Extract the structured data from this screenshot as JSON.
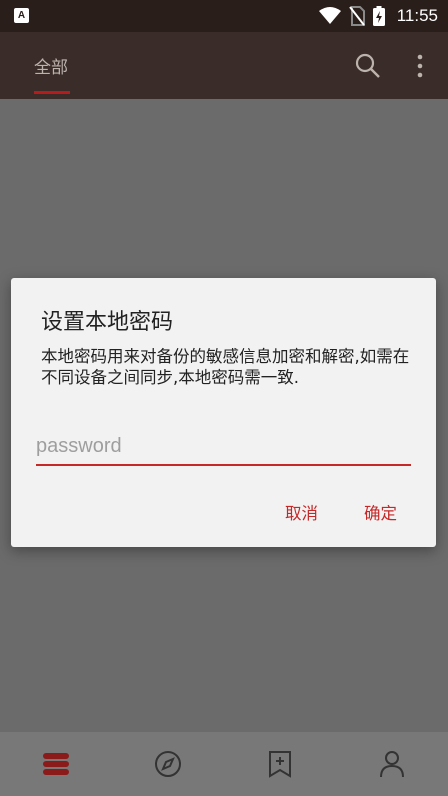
{
  "status_bar": {
    "notification_icon": "a-icon",
    "notification_letter": "A",
    "time": "11:55"
  },
  "app_bar": {
    "tab_all": "全部"
  },
  "dialog": {
    "title": "设置本地密码",
    "message": "本地密码用来对备份的敏感信息加密和解密,如需在不同设备之间同步,本地密码需一致.",
    "password_placeholder": "password",
    "password_value": "",
    "cancel_label": "取消",
    "confirm_label": "确定"
  },
  "bottom_nav": {
    "items": [
      "bookshelf-icon",
      "compass-icon",
      "bookmark-add-icon",
      "person-icon"
    ]
  },
  "colors": {
    "accent": "#c62828",
    "app_bar": "#3a2d29",
    "status_bar": "#2a1e1a"
  }
}
